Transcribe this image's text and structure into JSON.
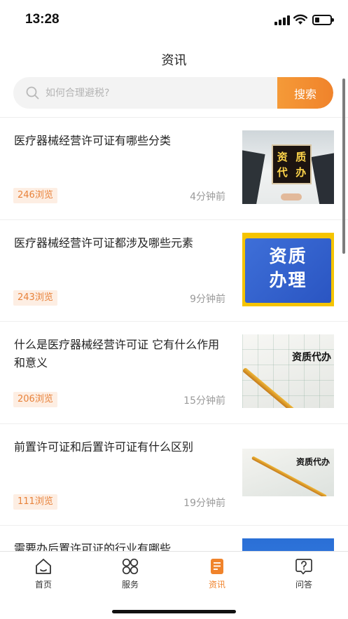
{
  "status_bar": {
    "time": "13:28"
  },
  "header": {
    "title": "资讯"
  },
  "search": {
    "placeholder": "如何合理避税?",
    "button_label": "搜索"
  },
  "news": [
    {
      "title": "医疗器械经营许可证有哪些分类",
      "views": "246浏览",
      "time": "4分钟前",
      "thumb_text": [
        "资",
        "质",
        "代",
        "办"
      ]
    },
    {
      "title": "医疗器械经营许可证都涉及哪些元素",
      "views": "243浏览",
      "time": "9分钟前",
      "thumb_text": [
        "资质",
        "办理"
      ]
    },
    {
      "title": "什么是医疗器械经营许可证 它有什么作用和意义",
      "views": "206浏览",
      "time": "15分钟前",
      "thumb_text": [
        "资质代办"
      ]
    },
    {
      "title": "前置许可证和后置许可证有什么区别",
      "views": "111浏览",
      "time": "19分钟前",
      "thumb_text": [
        "资质代办"
      ]
    },
    {
      "title": "需要办后置许可证的行业有哪些",
      "views": "",
      "time": ""
    }
  ],
  "tabs": [
    {
      "label": "首页",
      "icon": "home-icon",
      "active": false
    },
    {
      "label": "服务",
      "icon": "services-icon",
      "active": false
    },
    {
      "label": "资讯",
      "icon": "news-icon",
      "active": true
    },
    {
      "label": "问答",
      "icon": "qa-icon",
      "active": false
    }
  ],
  "colors": {
    "accent": "#F0832B",
    "badge_bg": "#FDEEE3",
    "badge_text": "#E8823A"
  }
}
